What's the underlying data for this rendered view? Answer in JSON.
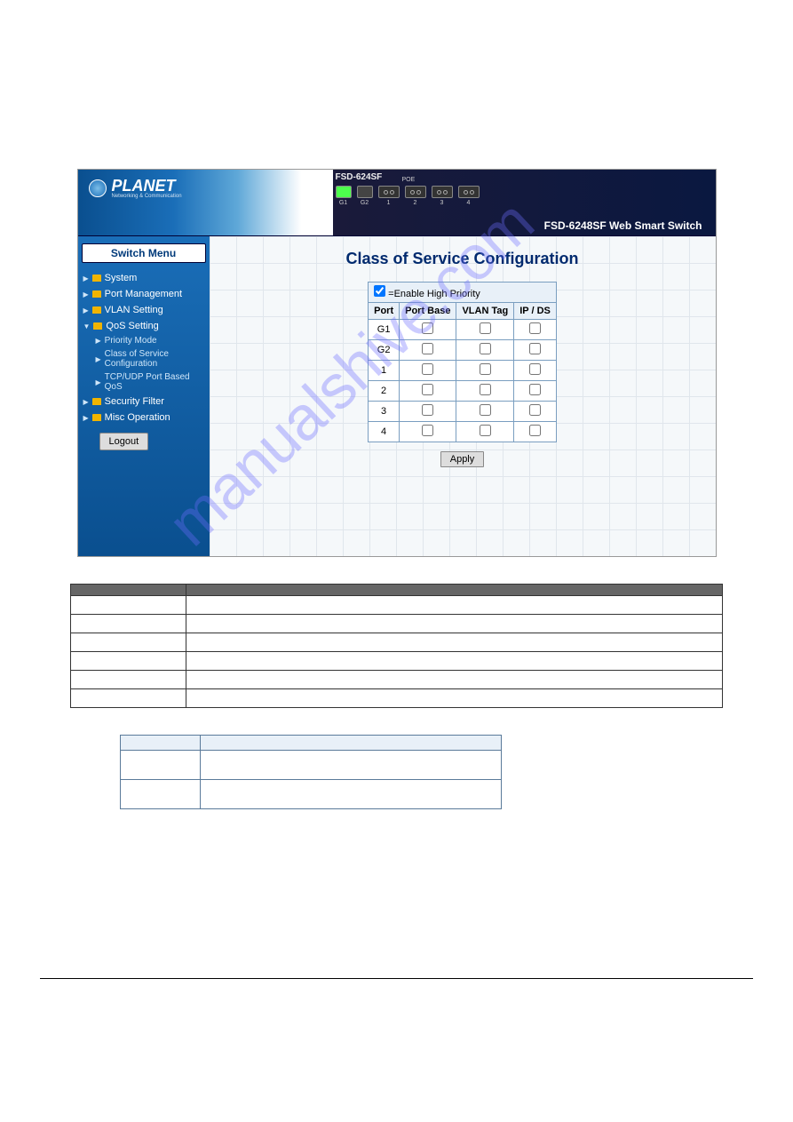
{
  "banner": {
    "device_model": "FSD-624SF",
    "title_right": "FSD-6248SF Web Smart Switch",
    "logo_text": "PLANET",
    "logo_sub": "Networking & Communication",
    "poe_label": "POE",
    "g_ports": [
      "G1",
      "G2"
    ],
    "poe_ports": [
      "1",
      "2",
      "3",
      "4"
    ]
  },
  "sidebar": {
    "menu_title": "Switch Menu",
    "items": [
      "System",
      "Port Management",
      "VLAN Setting",
      "QoS Setting"
    ],
    "sub_items": [
      "Priority Mode",
      "Class of Service Configuration",
      "TCP/UDP Port Based QoS"
    ],
    "items_after": [
      "Security Filter",
      "Misc Operation"
    ],
    "logout": "Logout"
  },
  "main": {
    "heading": "Class of Service Configuration",
    "enable_label": "=Enable High Priority",
    "columns": [
      "Port",
      "Port Base",
      "VLAN Tag",
      "IP / DS"
    ],
    "rows": [
      "G1",
      "G2",
      "1",
      "2",
      "3",
      "4"
    ],
    "apply": "Apply"
  },
  "desc_table": {
    "header_left": "",
    "header_right": "",
    "rows_left": [
      "",
      "",
      "",
      "",
      "",
      ""
    ]
  },
  "vlan_table": {
    "header_left": "",
    "header_right": "",
    "rows": [
      "",
      ""
    ]
  },
  "watermark": "manualshive.com",
  "page_number": ""
}
